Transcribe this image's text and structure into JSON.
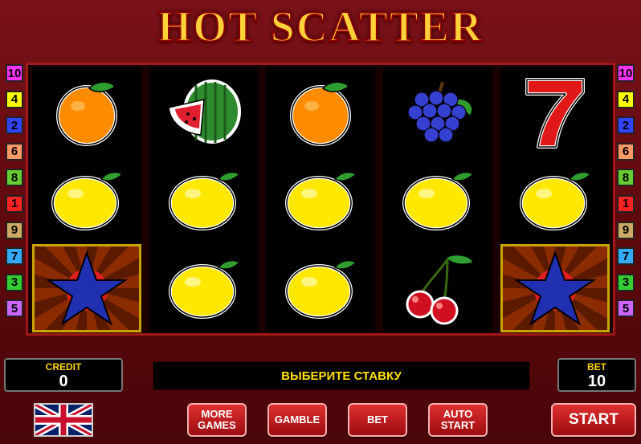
{
  "title": "HOT SCATTER",
  "line_numbers": [
    "10",
    "4",
    "2",
    "6",
    "8",
    "1",
    "9",
    "7",
    "3",
    "5"
  ],
  "line_colors": [
    "#ff33ff",
    "#ffff00",
    "#3344ff",
    "#ff9966",
    "#66cc33",
    "#ff2222",
    "#ccaa66",
    "#33aaff",
    "#33cc33",
    "#cc66ff"
  ],
  "reels": [
    [
      "orange",
      "lemon",
      "star"
    ],
    [
      "watermelon",
      "lemon",
      "lemon"
    ],
    [
      "orange",
      "lemon",
      "lemon"
    ],
    [
      "grapes",
      "lemon",
      "cherries"
    ],
    [
      "seven",
      "lemon",
      "star"
    ]
  ],
  "credit": {
    "label": "CREDIT",
    "value": "0"
  },
  "bet": {
    "label": "BET",
    "value": "10"
  },
  "message": "ВЫБЕРИТЕ СТАВКУ",
  "buttons": {
    "more_games": "MORE GAMES",
    "gamble": "GAMBLE",
    "bet": "BET",
    "auto_start": "AUTO START",
    "start": "START"
  },
  "language_flag": "uk-flag-icon"
}
